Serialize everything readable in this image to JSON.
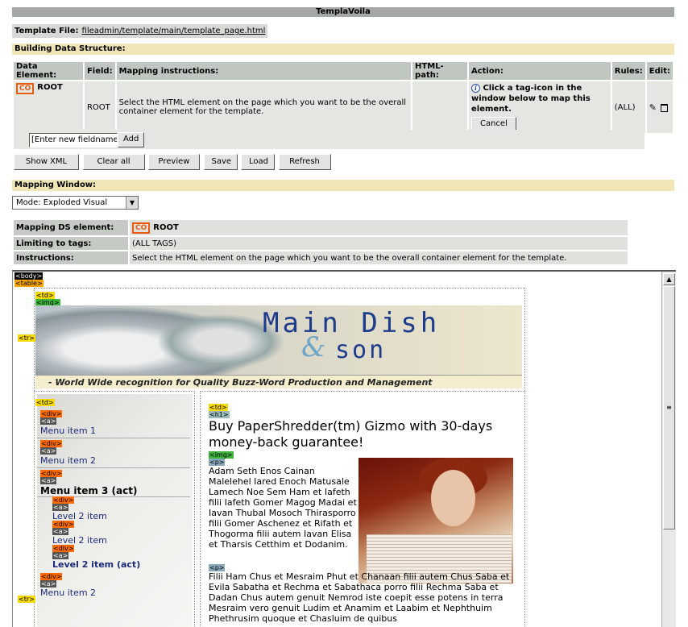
{
  "title": "TemplaVoila",
  "template_file": {
    "label": "Template File:",
    "path": "fileadmin/template/main/template_page.html"
  },
  "building_header": "Building Data Structure:",
  "ds_table": {
    "headers": [
      "Data Element:",
      "Field:",
      "Mapping instructions:",
      "HTML-path:",
      "Action:",
      "Rules:",
      "Edit:"
    ],
    "row": {
      "badge": "CO",
      "element": "ROOT",
      "field": "ROOT",
      "instructions": "Select the HTML element on the page which you want to be the overall container element for the template.",
      "html_path": "",
      "action_text": "Click a tag-icon in the window below to map this element.",
      "cancel_label": "Cancel",
      "rules": "(ALL)"
    }
  },
  "new_field": {
    "placeholder": "[Enter new fieldname]",
    "add_label": "Add"
  },
  "buttons": [
    "Show XML",
    "Clear all",
    "Preview",
    "Save",
    "Load",
    "Refresh"
  ],
  "mapping_header": "Mapping Window:",
  "mode_select": {
    "value": "Mode: Exploded Visual"
  },
  "mapping_table": {
    "ds_label": "Mapping DS element:",
    "ds_badge": "CO",
    "ds_value": "ROOT",
    "limit_label": "Limiting to tags:",
    "limit_value": "(ALL TAGS)",
    "instr_label": "Instructions:",
    "instr_value": "Select the HTML element on the page which you want to be the overall container element for the template."
  },
  "preview": {
    "tags": {
      "body": "<body>",
      "table": "<table>",
      "tr": "<tr>",
      "td": "<td>",
      "img": "<img>",
      "div": "<div>",
      "a": "<a>",
      "h1": "<h1>",
      "p": "<p>"
    },
    "banner_title": "Main Dish",
    "banner_amp": "&",
    "banner_son": "son",
    "banner_tagline": "- World Wide recognition for Quality Buzz-Word Production and Management",
    "menu": [
      "Menu item 1",
      "Menu item 2",
      "Menu item 3 (act)",
      "Level 2 item",
      "Level 2 item",
      "Level 2 item (act)",
      "Menu item 2"
    ],
    "heading": "Buy PaperShredder(tm) Gizmo with 30-days money-back guarantee!",
    "para1": "Adam Seth Enos Cainan Malelehel Iared Enoch Matusale Lamech Noe Sem Ham et Iafeth filii Iafeth Gomer Magog Madai et Iavan Thubal Mosoch Thirasporro filii Gomer Aschenez et Rifath et Thogorma filii autem Iavan Elisa et Tharsis Cetthim et Dodanim.",
    "para2": "Filii Ham Chus et Mesraim Phut et Chanaan filii autem Chus Saba et Evila Sabatha et Rechma et Sabathaca porro filii Rechma Saba et Dadan Chus autem genuit Nemrod iste coepit esse potens in terra Mesraim vero genuit Ludim et Anamim et Laabim et Nephthuim Phethrusim quoque et Chasluim de quibus"
  }
}
